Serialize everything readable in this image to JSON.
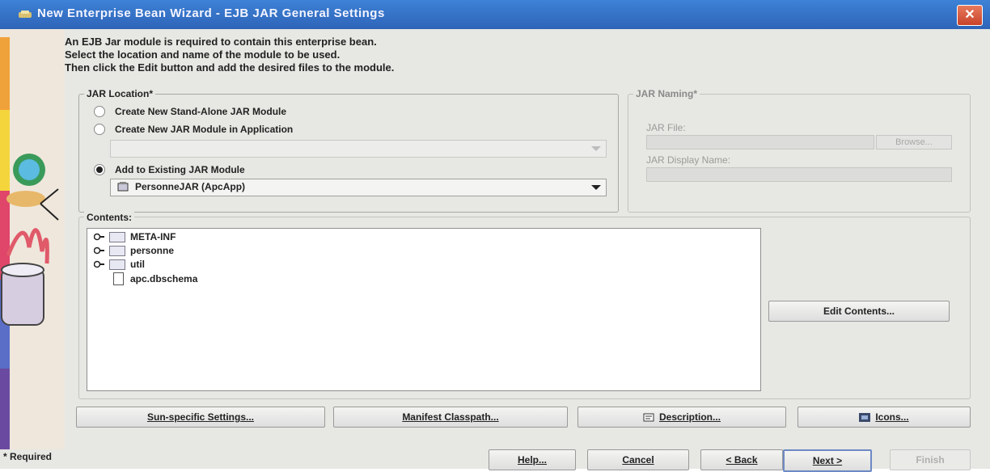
{
  "window": {
    "title": "New Enterprise Bean Wizard - EJB JAR General Settings",
    "close_glyph": "✕"
  },
  "intro": {
    "line1": "An EJB Jar module is required to contain this enterprise bean.",
    "line2": "Select the location and name of the module to be used.",
    "line3": "Then click the Edit button and add the desired files to the module."
  },
  "jar_location": {
    "legend": "JAR Location*",
    "option_standalone": "Create New Stand-Alone JAR Module",
    "option_in_app": "Create New JAR Module in Application",
    "app_combo_value": "",
    "option_existing": "Add to Existing JAR Module",
    "selected_option": "existing",
    "existing_combo_value": "PersonneJAR (ApcApp)"
  },
  "jar_naming": {
    "legend": "JAR Naming*",
    "jar_file_label": "JAR File:",
    "browse_label": "Browse...",
    "display_name_label": "JAR Display Name:"
  },
  "contents": {
    "label": "Contents:",
    "items": [
      {
        "name": "META-INF",
        "type": "folder"
      },
      {
        "name": "personne",
        "type": "folder"
      },
      {
        "name": "util",
        "type": "folder"
      },
      {
        "name": "apc.dbschema",
        "type": "file"
      }
    ],
    "edit_button": "Edit Contents..."
  },
  "actions": {
    "sun_settings": "Sun-specific Settings...",
    "manifest": "Manifest Classpath...",
    "description": "Description...",
    "icons": "Icons..."
  },
  "footer": {
    "required_note": "* Required",
    "help": "Help...",
    "cancel": "Cancel",
    "back": "< Back",
    "next": "Next >",
    "finish": "Finish"
  },
  "colors": {
    "titlebar": "#3d82d6",
    "dialog_bg": "#e7e7e3",
    "close_button": "#d55a3c"
  },
  "icons": [
    "wizard-art-icon",
    "close-icon",
    "jar-icon",
    "folder-icon",
    "file-icon",
    "tree-toggle-icon",
    "description-icon",
    "icons-icon",
    "chevron-down-icon"
  ]
}
